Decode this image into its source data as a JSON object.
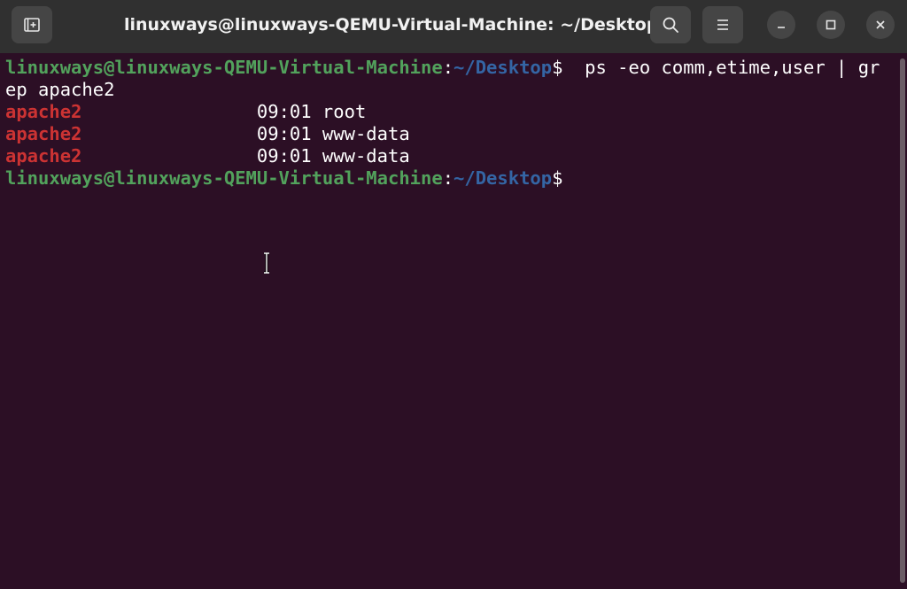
{
  "window": {
    "title": "linuxways@linuxways-QEMU-Virtual-Machine: ~/Desktop"
  },
  "titlebar": {
    "new_tab_icon": "new-tab-icon",
    "search_icon": "search-icon",
    "menu_icon": "hamburger-menu-icon",
    "minimize_icon": "minimize-icon",
    "maximize_icon": "maximize-icon",
    "close_icon": "close-icon"
  },
  "terminal": {
    "prompt_user": "linuxways@linuxways-QEMU-Virtual-Machine",
    "prompt_colon": ":",
    "prompt_path": "~/Desktop",
    "prompt_dollar": "$",
    "command_part1": "  ps -eo comm,etime,user | gr",
    "command_part2": "ep apache2",
    "output": [
      {
        "comm": "apache2",
        "rest": "                09:01 root"
      },
      {
        "comm": "apache2",
        "rest": "                09:01 www-data"
      },
      {
        "comm": "apache2",
        "rest": "                09:01 www-data"
      }
    ]
  },
  "colors": {
    "background": "#2c0f25",
    "titlebar": "#303030",
    "prompt_user": "#52a25c",
    "prompt_path": "#3465a4",
    "match_highlight": "#cc3333"
  }
}
